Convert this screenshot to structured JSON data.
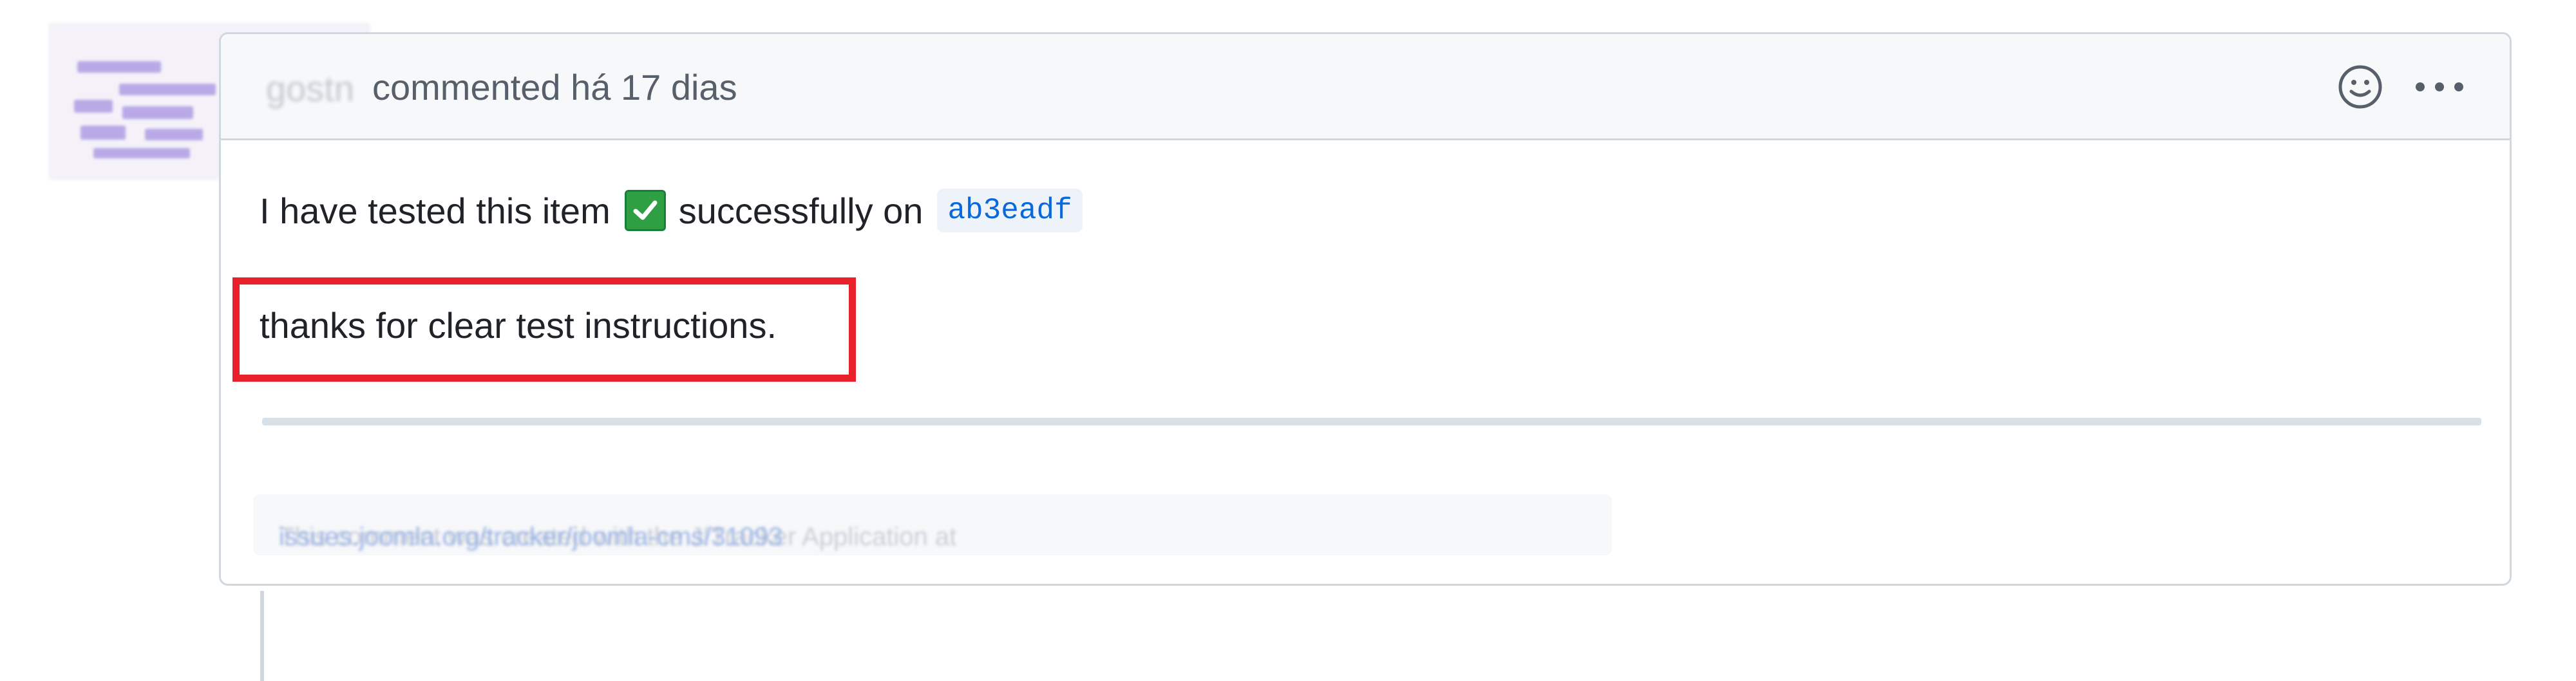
{
  "comment": {
    "author": "gostn",
    "verb": "commented",
    "time": "há 17 dias",
    "line1_prefix": "I have tested this item",
    "line1_suffix": "successfully on",
    "commit_hash": "ab3eadf",
    "line2": "thanks for clear test instructions.",
    "footer_prefix": "This comment was created with the J!Tracker Application at",
    "footer_link": "issues.joomla.org/tracker/joomla-cms/31093"
  },
  "colors": {
    "highlight": "#e8202a",
    "check": "#2ea043",
    "link": "#0969da"
  },
  "icons": [
    "smiley-icon",
    "kebab-menu-icon",
    "check-mark-icon"
  ]
}
